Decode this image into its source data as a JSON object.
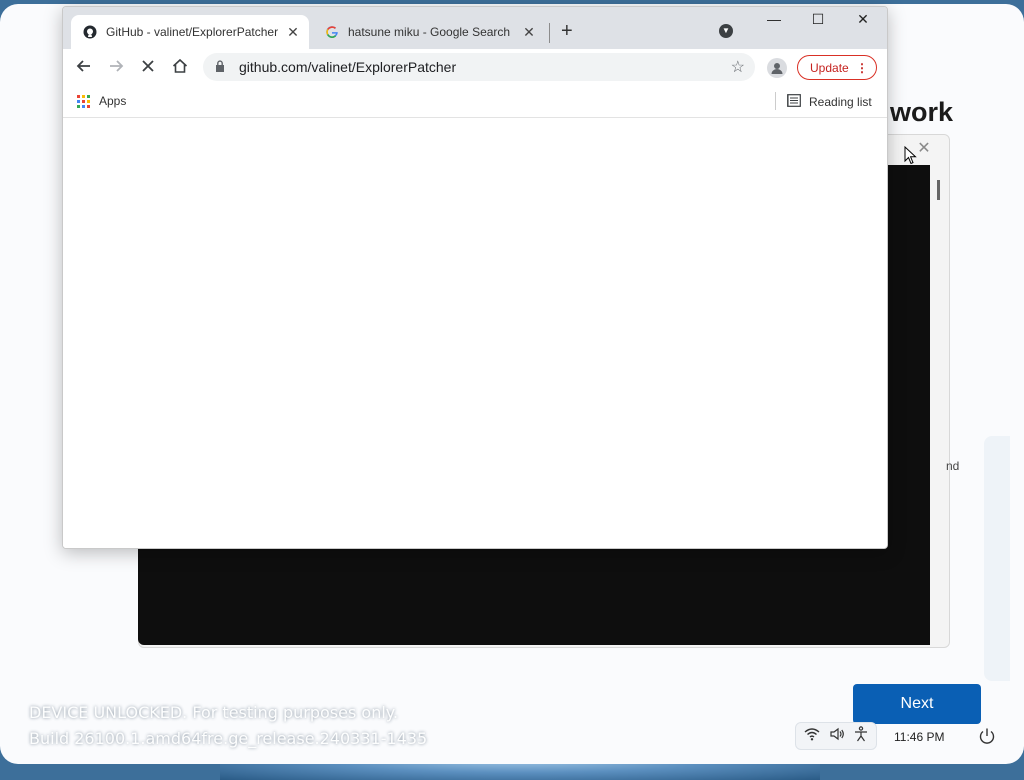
{
  "oobe": {
    "heading_fragment": "work",
    "side_text_fragment": "nd",
    "next_label": "Next",
    "embed_close_glyph": "✕"
  },
  "watermark": {
    "line1": "DEVICE UNLOCKED. For testing purposes only.",
    "line2": "Build 26100.1.amd64fre.ge_release.240331-1435"
  },
  "taskbar": {
    "time": "11:46 PM",
    "tray_icons": [
      "wifi-icon",
      "volume-icon",
      "accessibility-icon"
    ]
  },
  "browser": {
    "tabs": [
      {
        "title": "GitHub - valinet/ExplorerPatcher",
        "favicon": "github-icon",
        "active": true
      },
      {
        "title": "hatsune miku - Google Search",
        "favicon": "google-icon",
        "active": false
      }
    ],
    "new_tab_glyph": "+",
    "window_controls": {
      "minimize": "—",
      "maximize": "☐",
      "close": "✕"
    },
    "address": "github.com/valinet/ExplorerPatcher",
    "update_label": "Update",
    "bookmarks": {
      "apps_label": "Apps",
      "reading_list_label": "Reading list"
    },
    "loading": true
  },
  "colors": {
    "accent": "#0a5fb4",
    "update_red": "#d93025",
    "tab_strip": "#dee1e6"
  }
}
